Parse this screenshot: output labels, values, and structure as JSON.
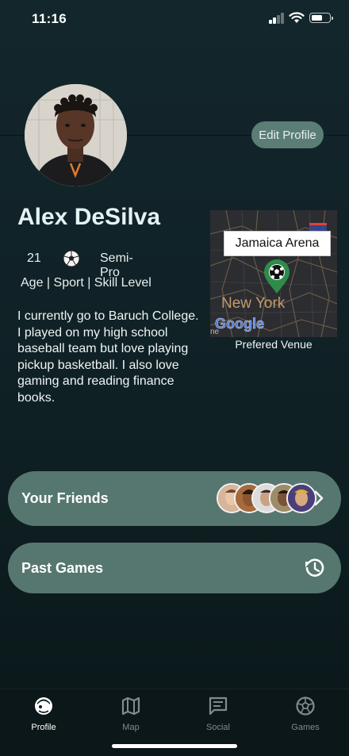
{
  "status_bar": {
    "time": "11:16",
    "signal_icon": "signal-icon",
    "wifi_icon": "wifi-icon",
    "battery_icon": "battery-icon"
  },
  "profile": {
    "name": "Alex DeSilva",
    "edit_label": "Edit Profile",
    "age": "21",
    "sport_icon": "soccer-ball-icon",
    "skill_level": "Semi-Pro",
    "stats_caption": "Age | Sport | Skill Level",
    "bio": "I currently go to Baruch College. I played on my high school baseball team but love playing pickup basketball. I also love gaming and reading finance books."
  },
  "venue": {
    "name": "Jamaica Arena",
    "caption": "Prefered Venue",
    "map_city_label": "New York",
    "map_logo": "Google"
  },
  "cards": {
    "friends_label": "Your Friends",
    "friends_avatar_count": 5,
    "past_games_label": "Past Games",
    "history_icon": "history-icon",
    "chevron_icon": "chevron-right-icon"
  },
  "tabs": [
    {
      "label": "Profile",
      "icon": "profile-icon",
      "active": true
    },
    {
      "label": "Map",
      "icon": "map-icon",
      "active": false
    },
    {
      "label": "Social",
      "icon": "chat-icon",
      "active": false
    },
    {
      "label": "Games",
      "icon": "soccer-ball-icon",
      "active": false
    }
  ],
  "colors": {
    "card_bg": "#56776f",
    "edit_button_bg": "#5a7d76",
    "name_text": "#e4f2f4",
    "background_top": "#13262c"
  }
}
